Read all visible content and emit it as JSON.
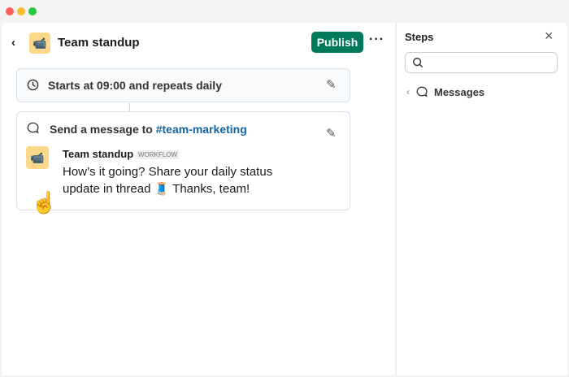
{
  "header": {
    "title": "Team standup",
    "publish_label": "Publish"
  },
  "trigger": {
    "text": "Starts at 09:00 and repeats daily"
  },
  "message_step": {
    "prefix": "Send a message to ",
    "channel": "#team-marketing",
    "sender": "Team standup",
    "badge": "WORKFLOW",
    "line1": "How’s it going? Share your daily status",
    "line2": "update in thread 🧵 Thanks, team!"
  },
  "steps_panel": {
    "title": "Steps",
    "search_placeholder": "",
    "category": "Messages"
  },
  "colors": {
    "accent": "#007a5a",
    "link": "#1264a3"
  }
}
